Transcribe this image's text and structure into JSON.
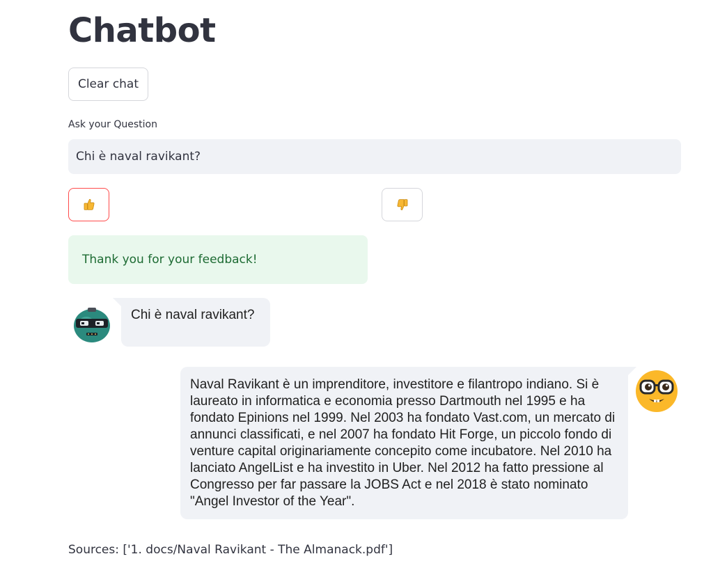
{
  "app": {
    "title": "Chatbot"
  },
  "toolbar": {
    "clear_label": "Clear chat"
  },
  "question": {
    "label": "Ask your Question",
    "value": "Chi è naval ravikant?"
  },
  "feedback": {
    "up_icon": "thumbs-up-icon",
    "down_icon": "thumbs-down-icon",
    "selected": "up",
    "success_message": "Thank you for your feedback!"
  },
  "messages": [
    {
      "role": "bot",
      "avatar": "robot-avatar",
      "text": "Chi è naval ravikant?"
    },
    {
      "role": "user",
      "avatar": "nerd-face-avatar",
      "text": "Naval Ravikant è un imprenditore, investitore e filantropo indiano. Si è laureato in informatica e economia presso Dartmouth nel 1995 e ha fondato Epinions nel 1999. Nel 2003 ha fondato Vast.com, un mercato di annunci classificati, e nel 2007 ha fondato Hit Forge, un piccolo fondo di venture capital originariamente concepito come incubatore. Nel 2010 ha lanciato AngelList e ha investito in Uber. Nel 2012 ha fatto pressione al Congresso per far passare la JOBS Act e nel 2018 è stato nominato \"Angel Investor of the Year\"."
    }
  ],
  "sources": "Sources: ['1. docs/Naval Ravikant - The Almanack.pdf']",
  "colors": {
    "accent": "#ff4b4b",
    "success_bg": "#e9f8ed",
    "success_text": "#1d6b33",
    "bubble_bg": "#f0f2f6",
    "avatar_yellow": "#fbb829",
    "robot_teal": "#2b8a7e"
  }
}
